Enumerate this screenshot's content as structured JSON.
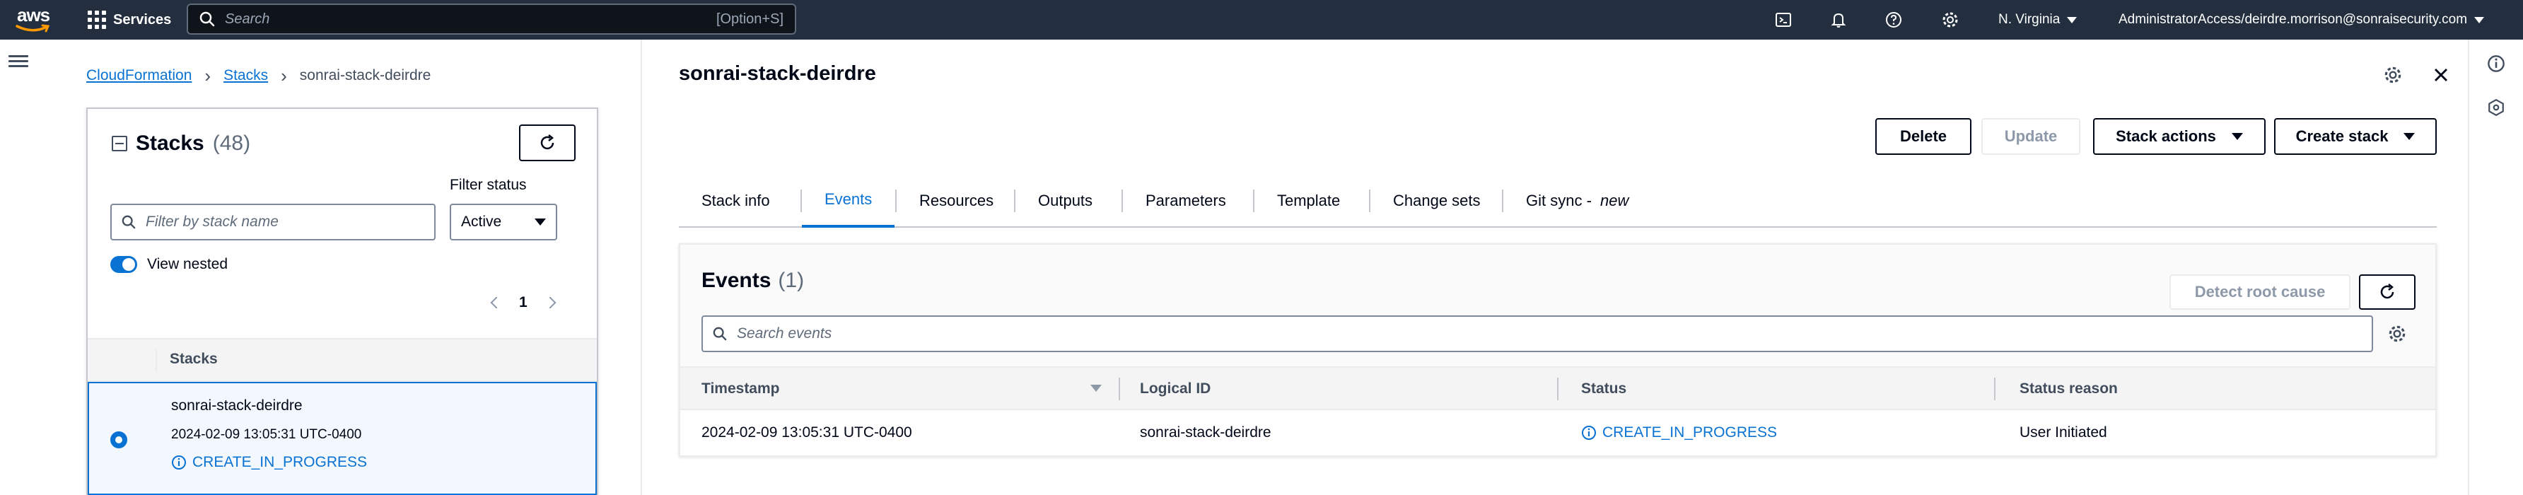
{
  "topnav": {
    "logo_text": "aws",
    "services_label": "Services",
    "search_placeholder": "Search",
    "search_shortcut": "[Option+S]",
    "region": "N. Virginia",
    "account": "AdministratorAccess/deirdre.morrison@sonraisecurity.com"
  },
  "breadcrumb": {
    "items": [
      "CloudFormation",
      "Stacks"
    ],
    "current": "sonrai-stack-deirdre"
  },
  "stacks_panel": {
    "title": "Stacks",
    "count": "(48)",
    "filter_placeholder": "Filter by stack name",
    "filter_status_label": "Filter status",
    "filter_status_value": "Active",
    "view_nested_label": "View nested",
    "view_nested_on": true,
    "page_number": "1",
    "column_header": "Stacks",
    "rows": [
      {
        "name": "sonrai-stack-deirdre",
        "timestamp": "2024-02-09 13:05:31 UTC-0400",
        "status": "CREATE_IN_PROGRESS",
        "selected": true
      }
    ]
  },
  "detail": {
    "title": "sonrai-stack-deirdre",
    "buttons": {
      "delete": "Delete",
      "update": "Update",
      "stack_actions": "Stack actions",
      "create_stack": "Create stack"
    },
    "tabs": [
      {
        "label": "Stack info",
        "active": false
      },
      {
        "label": "Events",
        "active": true
      },
      {
        "label": "Resources",
        "active": false
      },
      {
        "label": "Outputs",
        "active": false
      },
      {
        "label": "Parameters",
        "active": false
      },
      {
        "label": "Template",
        "active": false
      },
      {
        "label": "Change sets",
        "active": false
      },
      {
        "label": "Git sync - ",
        "suffix": "new",
        "active": false
      }
    ]
  },
  "events": {
    "title": "Events",
    "count": "(1)",
    "detect_root_cause": "Detect root cause",
    "search_placeholder": "Search events",
    "columns": [
      "Timestamp",
      "Logical ID",
      "Status",
      "Status reason"
    ],
    "rows": [
      {
        "timestamp": "2024-02-09 13:05:31 UTC-0400",
        "logical_id": "sonrai-stack-deirdre",
        "status": "CREATE_IN_PROGRESS",
        "status_reason": "User Initiated"
      }
    ]
  },
  "colors": {
    "nav_bg": "#232f3e",
    "link": "#0972d3",
    "text": "#000716",
    "border": "#c6c6cd"
  },
  "icons": [
    "grid-icon",
    "search-icon",
    "cloudshell-icon",
    "bell-icon",
    "help-icon",
    "settings-icon",
    "menu-icon",
    "refresh-icon",
    "info-icon",
    "close-icon",
    "gear-icon"
  ]
}
